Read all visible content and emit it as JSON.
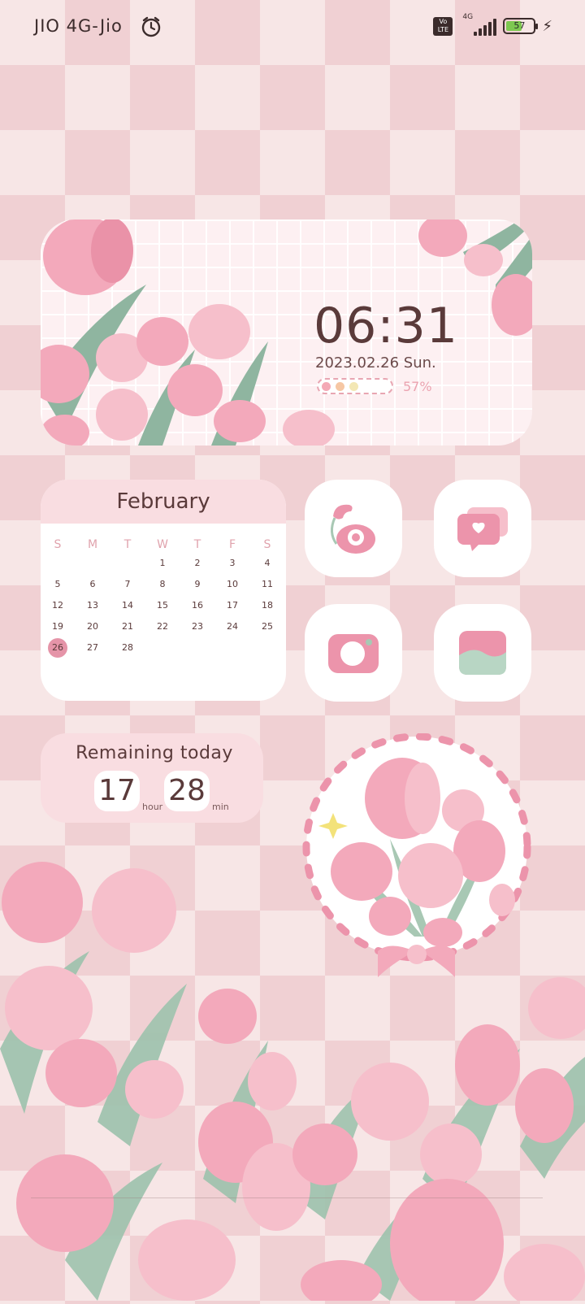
{
  "status_bar": {
    "carrier": "JIO 4G-Jio",
    "volte_line1": "Vo",
    "volte_line2": "LTE",
    "signal_label": "4G",
    "battery_value": "57",
    "battery_level": 0.57,
    "alarm_icon": "alarm-clock-icon",
    "charging_icon": "lightning-icon"
  },
  "clock_widget": {
    "time": "06:31",
    "date": "2023.02.26 Sun.",
    "battery_percent": "57%",
    "battery_dot_colors": [
      "#f4a9b6",
      "#f6c7a4",
      "#f3e7b4"
    ]
  },
  "calendar": {
    "month": "February",
    "weekdays": [
      "S",
      "M",
      "T",
      "W",
      "T",
      "F",
      "S"
    ],
    "weeks": [
      [
        "",
        "",
        "",
        "1",
        "2",
        "3",
        "4"
      ],
      [
        "5",
        "6",
        "7",
        "8",
        "9",
        "10",
        "11"
      ],
      [
        "12",
        "13",
        "14",
        "15",
        "16",
        "17",
        "18"
      ],
      [
        "19",
        "20",
        "21",
        "22",
        "23",
        "24",
        "25"
      ],
      [
        "26",
        "27",
        "28",
        "",
        "",
        "",
        ""
      ]
    ],
    "today": "26"
  },
  "apps": [
    {
      "icon": "phone-icon"
    },
    {
      "icon": "message-icon"
    },
    {
      "icon": "camera-icon"
    },
    {
      "icon": "gallery-icon"
    }
  ],
  "remaining": {
    "title": "Remaining today",
    "hours": "17",
    "hour_unit": "hour",
    "minutes": "28",
    "min_unit": "min"
  },
  "colors": {
    "accent_pink": "#e594a8",
    "text_brown": "#5a3a3a",
    "leaf_green": "#a8c8b4"
  }
}
